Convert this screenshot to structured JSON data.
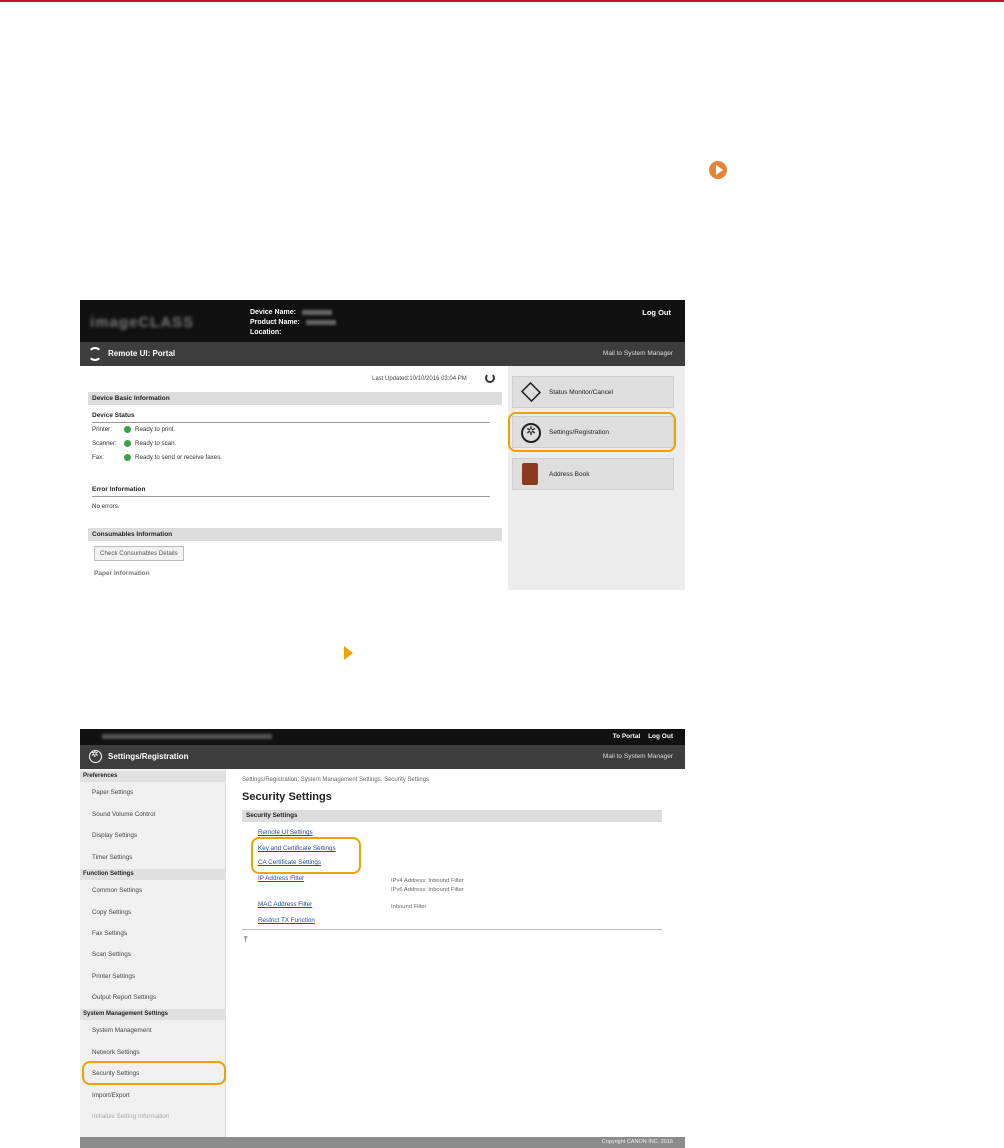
{
  "portal": {
    "logo": "imageCLASS",
    "device_name_label": "Device Name:",
    "product_name_label": "Product Name:",
    "location_label": "Location:",
    "logout": "Log Out",
    "title": "Remote UI: Portal",
    "mail": "Mail to System Manager",
    "last_updated": "Last Updated:10/10/2016 03:04 PM",
    "basic_info": "Device Basic Information",
    "device_status": "Device Status",
    "status_rows": [
      {
        "label": "Printer:",
        "value": "Ready to print."
      },
      {
        "label": "Scanner:",
        "value": "Ready to scan."
      },
      {
        "label": "Fax:",
        "value": "Ready to send or receive faxes."
      }
    ],
    "error_info": "Error Information",
    "no_errors": "No errors.",
    "consumables": "Consumables Information",
    "check_button": "Check Consumables Details",
    "paper_info": "Paper Information",
    "side_items": [
      "Status Monitor/Cancel",
      "Settings/Registration",
      "Address Book"
    ],
    "dot_color": "#3aa14a",
    "highlight_color": "#f0a000"
  },
  "settings": {
    "to_portal": "To Portal",
    "logout": "Log Out",
    "title": "Settings/Registration",
    "mail": "Mail to System Manager",
    "groups": [
      "Preferences",
      "Function Settings",
      "System Management Settings"
    ],
    "pref_items": [
      "Paper Settings",
      "Sound Volume Control",
      "Display Settings",
      "Timer Settings"
    ],
    "func_items": [
      "Common Settings",
      "Copy Settings",
      "Fax Settings",
      "Scan Settings",
      "Printer Settings",
      "Output Report Settings"
    ],
    "sys_items": [
      "System Management",
      "Network Settings",
      "Security Settings",
      "Import/Export",
      "Initialize Setting Information"
    ],
    "breadcrumb": "Settings/Registration: System Management Settings: Security Settings",
    "heading": "Security Settings",
    "section": "Security Settings",
    "links": [
      "Remote UI Settings",
      "Key and Certificate Settings",
      "CA Certificate Settings",
      "IP Address Filter",
      "MAC Address Filter",
      "Restrict TX Function"
    ],
    "ip_desc_1": "IPv4 Address: Inbound Filter",
    "ip_desc_2": "IPv6 Address: Inbound Filter",
    "mac_desc": "Inbound Filter",
    "copyright": "Copyright CANON INC. 2016"
  }
}
